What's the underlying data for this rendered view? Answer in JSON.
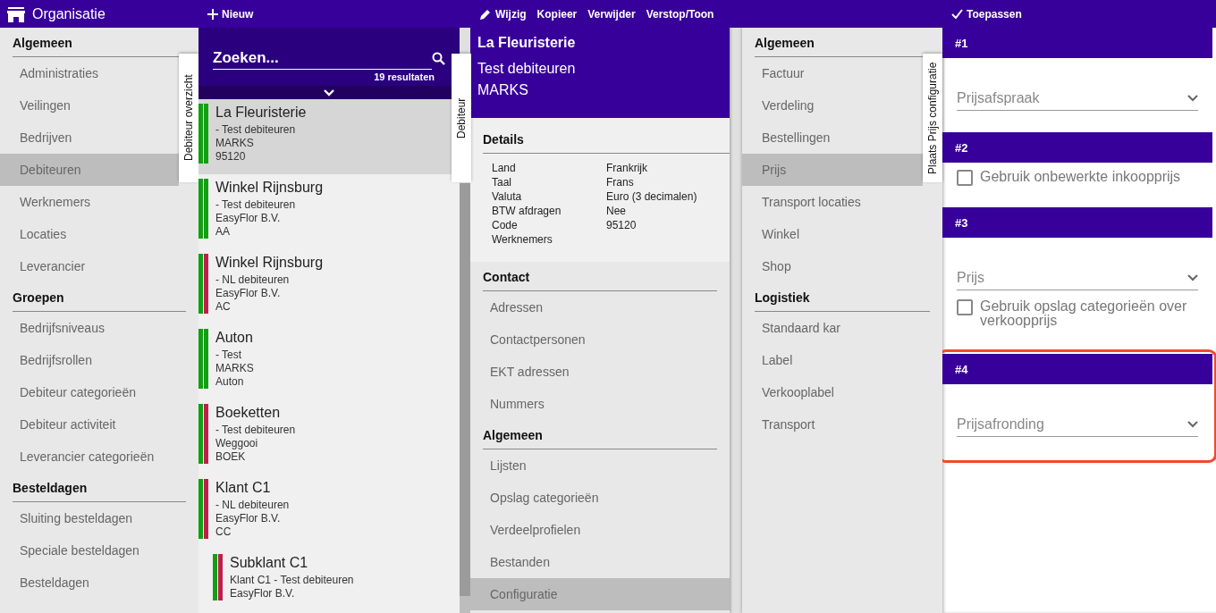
{
  "app_bar": {
    "title": "Organisatie"
  },
  "navigation": {
    "side_tab": "Debiteur overzicht",
    "sections": [
      {
        "heading": "Algemeen",
        "items": [
          {
            "label": "Administraties",
            "selected": false
          },
          {
            "label": "Veilingen",
            "selected": false
          },
          {
            "label": "Bedrijven",
            "selected": false
          },
          {
            "label": "Debiteuren",
            "selected": true
          },
          {
            "label": "Werknemers",
            "selected": false
          },
          {
            "label": "Locaties",
            "selected": false
          },
          {
            "label": "Leverancier",
            "selected": false
          }
        ]
      },
      {
        "heading": "Groepen",
        "items": [
          {
            "label": "Bedrijfsniveaus",
            "selected": false
          },
          {
            "label": "Bedrijfsrollen",
            "selected": false
          },
          {
            "label": "Debiteur categorieën",
            "selected": false
          },
          {
            "label": "Debiteur activiteit",
            "selected": false
          },
          {
            "label": "Leverancier categorieën",
            "selected": false
          }
        ]
      },
      {
        "heading": "Besteldagen",
        "items": [
          {
            "label": "Sluiting besteldagen",
            "selected": false
          },
          {
            "label": "Speciale besteldagen",
            "selected": false
          },
          {
            "label": "Besteldagen",
            "selected": false
          }
        ]
      }
    ]
  },
  "list_toolbar": {
    "buttons": [
      {
        "label": "Nieuw",
        "kind": "add"
      }
    ]
  },
  "search": {
    "placeholder": "Zoeken...",
    "result_count": "19 resultaten"
  },
  "debtors": [
    {
      "title": "La Fleuristerie",
      "lines": [
        "- Test debiteuren",
        "MARKS",
        "95120"
      ],
      "bars": [
        {
          "color": "#11a011"
        },
        {
          "color": "#11a011"
        }
      ],
      "selected": true
    },
    {
      "title": "Winkel Rijnsburg",
      "lines": [
        "- Test debiteuren",
        "EasyFlor B.V.",
        "AA"
      ],
      "bars": [
        {
          "color": "#11a011"
        },
        {
          "color": "#11a011"
        }
      ],
      "selected": false
    },
    {
      "title": "Winkel Rijnsburg",
      "lines": [
        "- NL debiteuren",
        "EasyFlor B.V.",
        "AC"
      ],
      "bars": [
        {
          "color": "#11a011"
        },
        {
          "color": "#c01e4a"
        }
      ],
      "selected": false
    },
    {
      "title": "Auton",
      "lines": [
        "- Test",
        "MARKS",
        "Auton"
      ],
      "bars": [
        {
          "color": "#11a011"
        },
        {
          "color": "#11a011"
        }
      ],
      "selected": false
    },
    {
      "title": "Boeketten",
      "lines": [
        "- Test debiteuren",
        "Weggooi",
        "BOEK"
      ],
      "bars": [
        {
          "color": "#11a011"
        },
        {
          "color": "#c01e4a"
        }
      ],
      "selected": false
    },
    {
      "title": "Klant C1",
      "lines": [
        "- NL debiteuren",
        "EasyFlor B.V.",
        "CC"
      ],
      "bars": [
        {
          "color": "#11a011"
        },
        {
          "color": "#c01e4a"
        }
      ],
      "selected": false,
      "children": [
        {
          "title": "Subklant C1",
          "lines": [
            "Klant C1 - Test debiteuren",
            "EasyFlor B.V."
          ],
          "bars": [
            {
              "color": "#11a011"
            },
            {
              "color": "#c01e4a"
            }
          ],
          "selected": false
        }
      ]
    }
  ],
  "detail_toolbar": {
    "buttons": [
      {
        "label": "Wijzig",
        "kind": "edit"
      },
      {
        "label": "Kopieer",
        "kind": "text"
      },
      {
        "label": "Verwijder",
        "kind": "text"
      },
      {
        "label": "Verstop/Toon",
        "kind": "text"
      }
    ]
  },
  "detail": {
    "title": "La Fleuristerie",
    "subtitle_lines": [
      "Test debiteuren",
      "MARKS"
    ],
    "side_tab": "Debiteur",
    "details_heading": "Details",
    "fields": [
      {
        "label": "Land",
        "value": "Frankrijk"
      },
      {
        "label": "Taal",
        "value": "Frans"
      },
      {
        "label": "Valuta",
        "value": "Euro (3 decimalen)"
      },
      {
        "label": "BTW afdragen",
        "value": "Nee"
      },
      {
        "label": "Code",
        "value": "95120"
      },
      {
        "label": "Werknemers"
      }
    ],
    "sections": [
      {
        "heading": "Contact",
        "items": [
          {
            "label": "Adressen",
            "selected": false
          },
          {
            "label": "Contactpersonen",
            "selected": false
          },
          {
            "label": "EKT adressen",
            "selected": false
          },
          {
            "label": "Nummers",
            "selected": false
          }
        ]
      },
      {
        "heading": "Algemeen",
        "items": [
          {
            "label": "Lijsten",
            "selected": false
          },
          {
            "label": "Opslag categorieën",
            "selected": false
          },
          {
            "label": "Verdeelprofielen",
            "selected": false
          },
          {
            "label": "Bestanden",
            "selected": false
          },
          {
            "label": "Configuratie",
            "selected": true
          }
        ]
      }
    ]
  },
  "config_nav": {
    "side_tab": "Plaats Prijs configuratie",
    "sections": [
      {
        "heading": "Algemeen",
        "items": [
          {
            "label": "Factuur",
            "selected": false
          },
          {
            "label": "Verdeling",
            "selected": false
          },
          {
            "label": "Bestellingen",
            "selected": false
          },
          {
            "label": "Prijs",
            "selected": true
          },
          {
            "label": "Transport locaties",
            "selected": false
          },
          {
            "label": "Winkel",
            "selected": false
          },
          {
            "label": "Shop",
            "selected": false
          }
        ]
      },
      {
        "heading": "Logistiek",
        "items": [
          {
            "label": "Standaard kar",
            "selected": false
          },
          {
            "label": "Label",
            "selected": false
          },
          {
            "label": "Verkooplabel",
            "selected": false
          },
          {
            "label": "Transport",
            "selected": false
          }
        ]
      }
    ]
  },
  "config_toolbar": {
    "buttons": [
      {
        "label": "Toepassen",
        "kind": "apply"
      }
    ]
  },
  "config": {
    "steps": [
      {
        "heading": "#1",
        "highlighted": false,
        "controls": [
          {
            "kind": "select",
            "placeholder": "Prijsafspraak"
          }
        ]
      },
      {
        "heading": "#2",
        "highlighted": false,
        "controls": [
          {
            "kind": "checkbox",
            "label": "Gebruik onbewerkte inkoopprijs",
            "checked": false
          }
        ]
      },
      {
        "heading": "#3",
        "highlighted": false,
        "controls": [
          {
            "kind": "select",
            "placeholder": "Prijs"
          },
          {
            "kind": "checkbox",
            "label": "Gebruik opslag categorieën over verkoopprijs",
            "checked": false
          }
        ]
      },
      {
        "heading": "#4",
        "highlighted": true,
        "controls": [
          {
            "kind": "select",
            "placeholder": "Prijsafronding"
          }
        ]
      }
    ]
  }
}
